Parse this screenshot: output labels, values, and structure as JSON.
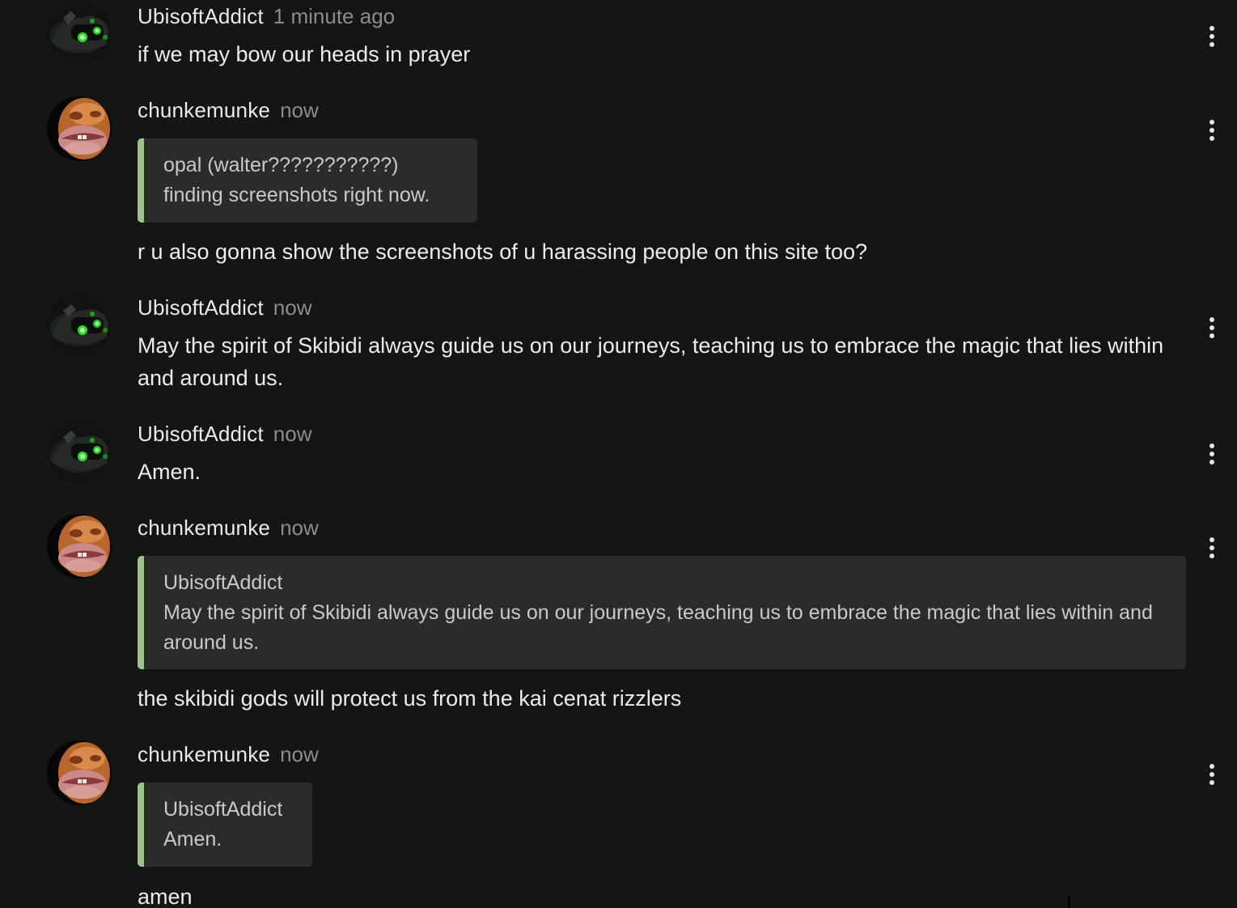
{
  "comments": [
    {
      "author": "UbisoftAddict",
      "time": "1 minute ago",
      "avatar": "goggles-avatar",
      "text": "if we may bow our heads in prayer"
    },
    {
      "author": "chunkemunke",
      "time": "now",
      "avatar": "face-avatar",
      "quote": {
        "author": "opal (walter???????????)",
        "text": "finding screenshots right now."
      },
      "text": "r u also gonna show the screenshots of u harassing people on this site too?"
    },
    {
      "author": "UbisoftAddict",
      "time": "now",
      "avatar": "goggles-avatar",
      "text": "May the spirit of Skibidi always guide us on our journeys, teaching us to embrace the magic that lies within and around us."
    },
    {
      "author": "UbisoftAddict",
      "time": "now",
      "avatar": "goggles-avatar",
      "text": "Amen."
    },
    {
      "author": "chunkemunke",
      "time": "now",
      "avatar": "face-avatar",
      "quote": {
        "author": "UbisoftAddict",
        "text": "May the spirit of Skibidi always guide us on our journeys, teaching us to embrace the magic that lies within and around us."
      },
      "text": "the skibidi gods will protect us from the kai cenat rizzlers"
    },
    {
      "author": "chunkemunke",
      "time": "now",
      "avatar": "face-avatar",
      "quote": {
        "author": "UbisoftAddict",
        "text": "Amen."
      },
      "text": "amen"
    }
  ],
  "colors": {
    "background": "#141614",
    "quote_background": "#2a2c29",
    "quote_accent": "#9bc48a",
    "timestamp": "#8c8d8a"
  },
  "icons": {
    "menu": "more-vertical-icon"
  }
}
